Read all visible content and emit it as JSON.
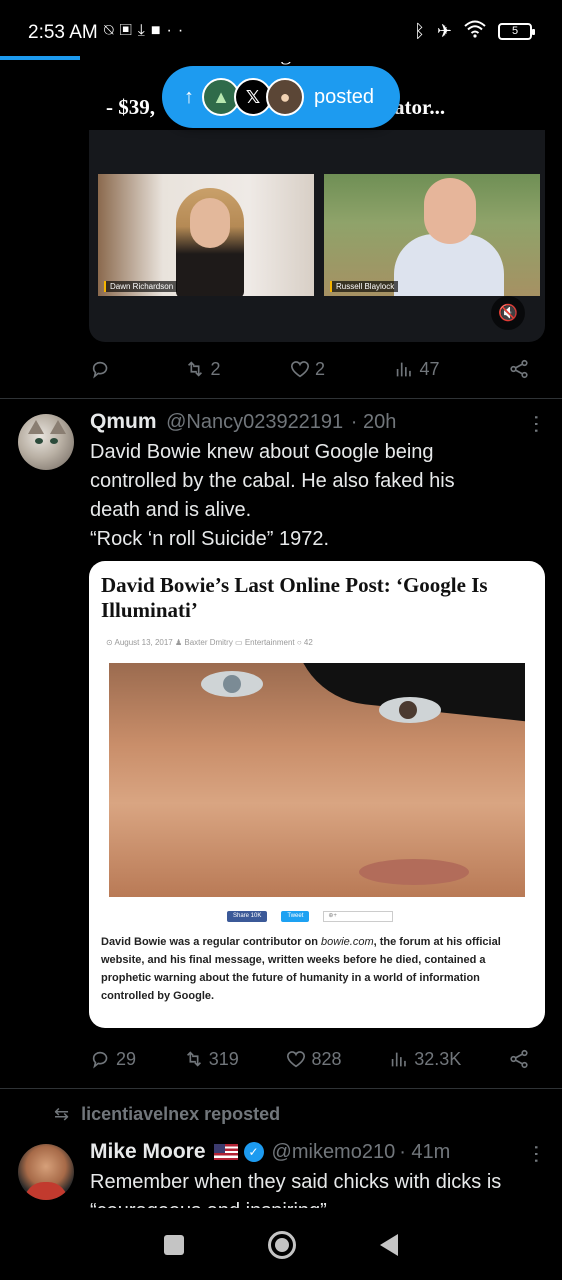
{
  "status_bar": {
    "time": "2:53 AM",
    "left_icons": [
      "notifications-off-icon",
      "sim-icon",
      "download-icon",
      "video-icon",
      "more-icon"
    ],
    "right_icons": [
      "bluetooth-icon",
      "airplane-icon",
      "wifi-icon"
    ],
    "battery_level": "5"
  },
  "top_tweet": {
    "line1": "The Truth Is Coming Out...",
    "line2_start": "- $39,",
    "line2_end": "ator...",
    "video": {
      "left_name": "Dawn Richardson",
      "right_name": "Russell Blaylock"
    },
    "actions": {
      "replies": "",
      "reposts": "2",
      "likes": "2",
      "views": "47"
    }
  },
  "posted_pill": {
    "label": "posted"
  },
  "tweet2": {
    "name": "Qmum",
    "handle": "@Nancy023922191",
    "time": "· 20h",
    "body_lines": [
      "David Bowie knew about Google being",
      "controlled by the cabal. He also faked his",
      "death and is alive.",
      "“Rock ‘n roll Suicide” 1972."
    ],
    "article": {
      "title": "David Bowie’s Last Online Post: ‘Google Is Illuminati’",
      "meta": "⊙ August 13, 2017   ♟ Baxter Dmitry   ▭ Entertainment   ○ 42",
      "share_fb": "Share 10K",
      "share_tw": "Tweet",
      "body_before": "David Bowie was a regular contributor on ",
      "body_site": "bowie.com",
      "body_after": ", the forum at his official website, and his final message, written weeks before he died, contained a prophetic warning about the future of humanity in a world of information controlled by Google."
    },
    "actions": {
      "replies": "29",
      "reposts": "319",
      "likes": "828",
      "views": "32.3K"
    }
  },
  "repost": {
    "label": "licentiavelnex reposted"
  },
  "tweet3": {
    "name": "Mike Moore",
    "handle": "@mikemo210",
    "time": "· 41m",
    "body_lines": [
      "Remember when they said chicks with dicks is",
      "“courageous and inspiring”"
    ]
  },
  "colors": {
    "accent": "#1d9bf0",
    "muted": "#71767b",
    "background": "#000000"
  }
}
